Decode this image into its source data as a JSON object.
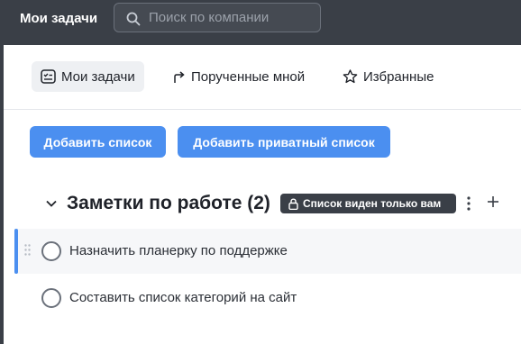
{
  "header": {
    "title": "Мои задачи",
    "search_placeholder": "Поиск по компании"
  },
  "tabs": [
    {
      "label": "Мои задачи",
      "icon": "task-list-icon",
      "active": true
    },
    {
      "label": "Порученные мной",
      "icon": "redirect-arrow-icon",
      "active": false
    },
    {
      "label": "Избранные",
      "icon": "star-icon",
      "active": false
    }
  ],
  "actions": {
    "add_list": "Добавить список",
    "add_private_list": "Добавить приватный список"
  },
  "list": {
    "title": "Заметки по работе (2)",
    "badge": "Список виден только вам",
    "badge_icon": "lock-icon",
    "tasks": [
      {
        "label": "Назначить планерку по поддержке",
        "highlighted": true
      },
      {
        "label": "Составить список категорий на сайт",
        "highlighted": false
      }
    ]
  },
  "colors": {
    "topbar": "#3a3f47",
    "accent": "#4b8ff0",
    "badge": "#3a3f47"
  }
}
